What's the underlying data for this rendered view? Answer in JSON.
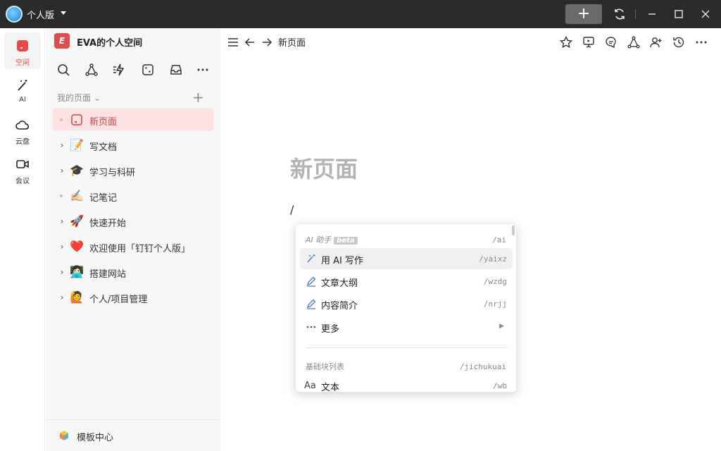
{
  "titlebar": {
    "app_name": "个人版",
    "new_label": "+",
    "icons": [
      "sync-icon",
      "minimize-icon",
      "maximize-icon",
      "close-icon"
    ]
  },
  "rail": {
    "items": [
      {
        "label": "空间",
        "icon": "space-icon",
        "active": true
      },
      {
        "label": "AI",
        "icon": "magic-wand-icon"
      },
      {
        "label": "云盘",
        "icon": "cloud-icon"
      },
      {
        "label": "会议",
        "icon": "video-icon"
      }
    ]
  },
  "sidebar": {
    "space_logo": "E",
    "space_name": "EVA的个人空间",
    "tools": [
      "search-icon",
      "graph-icon",
      "flash-icon",
      "dice-icon",
      "inbox-icon",
      "more-icon"
    ],
    "section_title": "我的页面",
    "items": [
      {
        "label": "新页面",
        "active": true,
        "expandable": false
      },
      {
        "label": "写文档",
        "emoji": "📝",
        "expandable": true
      },
      {
        "label": "学习与科研",
        "emoji": "🎓",
        "expandable": true
      },
      {
        "label": "记笔记",
        "emoji": "✍🏻",
        "expandable": false
      },
      {
        "label": "快速开始",
        "emoji": "🚀",
        "expandable": true
      },
      {
        "label": "欢迎使用「钉钉个人版」",
        "emoji": "❤️",
        "expandable": true
      },
      {
        "label": "搭建网站",
        "emoji": "👩🏻‍💻",
        "expandable": true
      },
      {
        "label": "个人/项目管理",
        "emoji": "🙋",
        "expandable": true
      }
    ],
    "footer_label": "模板中心"
  },
  "main": {
    "breadcrumb": "新页面",
    "page_title": "新页面",
    "slash_text": "/"
  },
  "menu": {
    "ai_section": "AI 助手",
    "ai_badge": "beta",
    "ai_shortcut": "/ai",
    "items": [
      {
        "label": "用 AI 写作",
        "shortcut": "/yaixz",
        "icon": "magic-wand-icon",
        "highlighted": true
      },
      {
        "label": "文章大纲",
        "shortcut": "/wzdg",
        "icon": "pencil-icon"
      },
      {
        "label": "内容简介",
        "shortcut": "/nrjj",
        "icon": "pencil-icon"
      },
      {
        "label": "更多",
        "icon": "more-icon",
        "submenu": true
      }
    ],
    "basic_section": "基础块列表",
    "basic_shortcut": "/jichukuai",
    "basic_items": [
      {
        "label": "文本",
        "shortcut": "/wb",
        "icon_text": "Aa"
      }
    ]
  }
}
